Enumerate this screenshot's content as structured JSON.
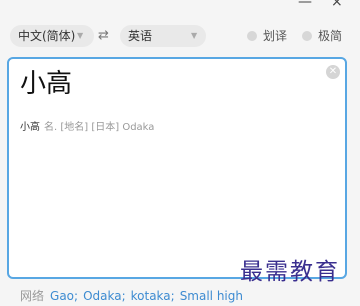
{
  "window": {
    "minimize_glyph": "—",
    "close_glyph": "×"
  },
  "langbar": {
    "source_lang": "中文(简体)",
    "target_lang": "英语",
    "toggle_huayi": "划译",
    "toggle_jijian": "极简"
  },
  "query": {
    "text": "小高"
  },
  "result": {
    "word": "小高",
    "definition": "名. [地名] [日本] Odaka"
  },
  "web": {
    "label": "网络",
    "links": [
      "Gao",
      "Odaka",
      "kotaka",
      "Small high"
    ]
  },
  "watermark": {
    "text": "最需教育"
  },
  "colors": {
    "accent_border": "#58a7e3",
    "link": "#3d8bd1",
    "watermark": "#3a2f8f"
  },
  "icons": {
    "swap": "swap-arrows-icon",
    "clear": "clear-circle-icon",
    "caret": "chevron-down-icon"
  }
}
